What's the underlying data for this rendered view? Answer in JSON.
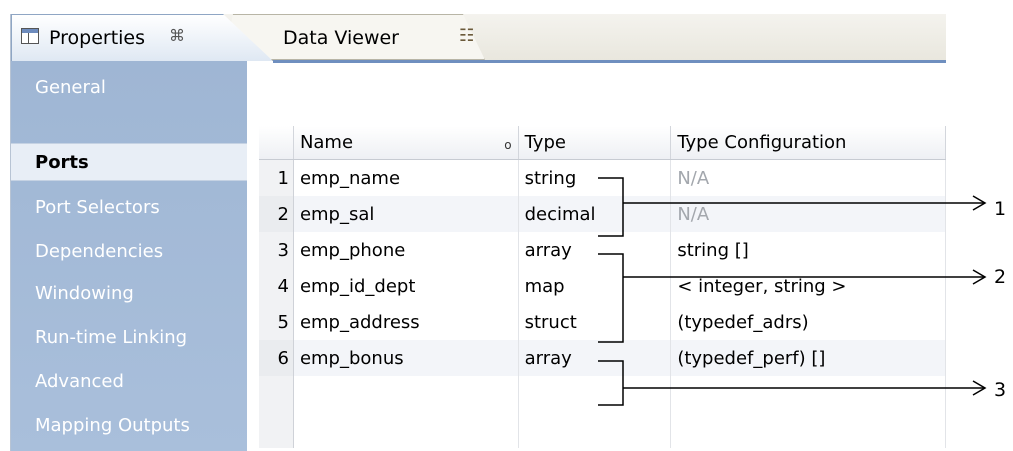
{
  "tabs": [
    {
      "label": "Properties",
      "close": "⌘"
    },
    {
      "label": "Data Viewer"
    }
  ],
  "sidebar": {
    "items": [
      {
        "label": "General"
      },
      {
        "label": "Ports"
      },
      {
        "label": "Port Selectors"
      },
      {
        "label": "Dependencies"
      },
      {
        "label": "Windowing"
      },
      {
        "label": "Run-time Linking"
      },
      {
        "label": "Advanced"
      },
      {
        "label": "Mapping Outputs"
      }
    ],
    "active": "Ports"
  },
  "ports_table": {
    "columns": [
      "Name",
      "Type",
      "Type Configuration"
    ],
    "rows": [
      {
        "num": "1",
        "name": "emp_name",
        "type": "string",
        "config": "N/A"
      },
      {
        "num": "2",
        "name": "emp_sal",
        "type": "decimal",
        "config": "N/A"
      },
      {
        "num": "3",
        "name": "emp_phone",
        "type": "array",
        "config": "string []"
      },
      {
        "num": "4",
        "name": "emp_id_dept",
        "type": "map",
        "config": "< integer, string >"
      },
      {
        "num": "5",
        "name": "emp_address",
        "type": "struct",
        "config": "(typedef_adrs)"
      },
      {
        "num": "6",
        "name": "emp_bonus",
        "type": "array",
        "config": "(typedef_perf) []"
      }
    ]
  },
  "callouts": [
    "1",
    "2",
    "3"
  ],
  "colors": {
    "sidebar": "#a3b9d7",
    "accent": "#6f8fbf",
    "na_text": "#a3a7ad"
  }
}
